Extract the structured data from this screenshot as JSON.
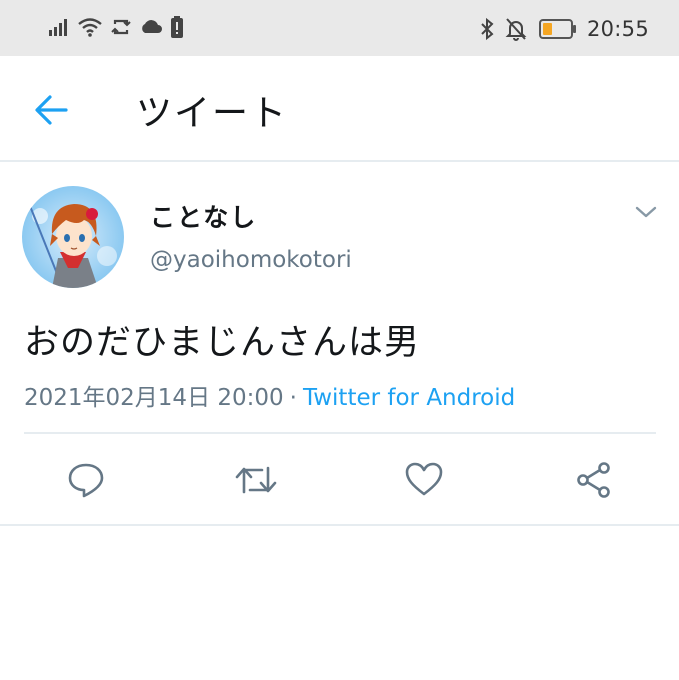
{
  "status_bar": {
    "time": "20:55",
    "icons": [
      "signal-icon",
      "wifi-icon",
      "sync-icon",
      "cloud-icon",
      "battery-saver-icon",
      "bluetooth-icon",
      "notifications-off-icon",
      "battery-icon"
    ],
    "battery_color": "#f5a623"
  },
  "header": {
    "title": "ツイート",
    "back_icon": "arrow-left-icon",
    "accent": "#1da1f2"
  },
  "tweet": {
    "display_name": "ことなし",
    "handle": "@yaoihomokotori",
    "text": "おのだひまじんさんは男",
    "timestamp": "2021年02月14日 20:00",
    "separator": "·",
    "source": "Twitter for Android",
    "actions": [
      {
        "name": "reply",
        "icon": "reply-icon"
      },
      {
        "name": "retweet",
        "icon": "retweet-icon"
      },
      {
        "name": "like",
        "icon": "heart-icon"
      },
      {
        "name": "share",
        "icon": "share-icon"
      }
    ]
  }
}
